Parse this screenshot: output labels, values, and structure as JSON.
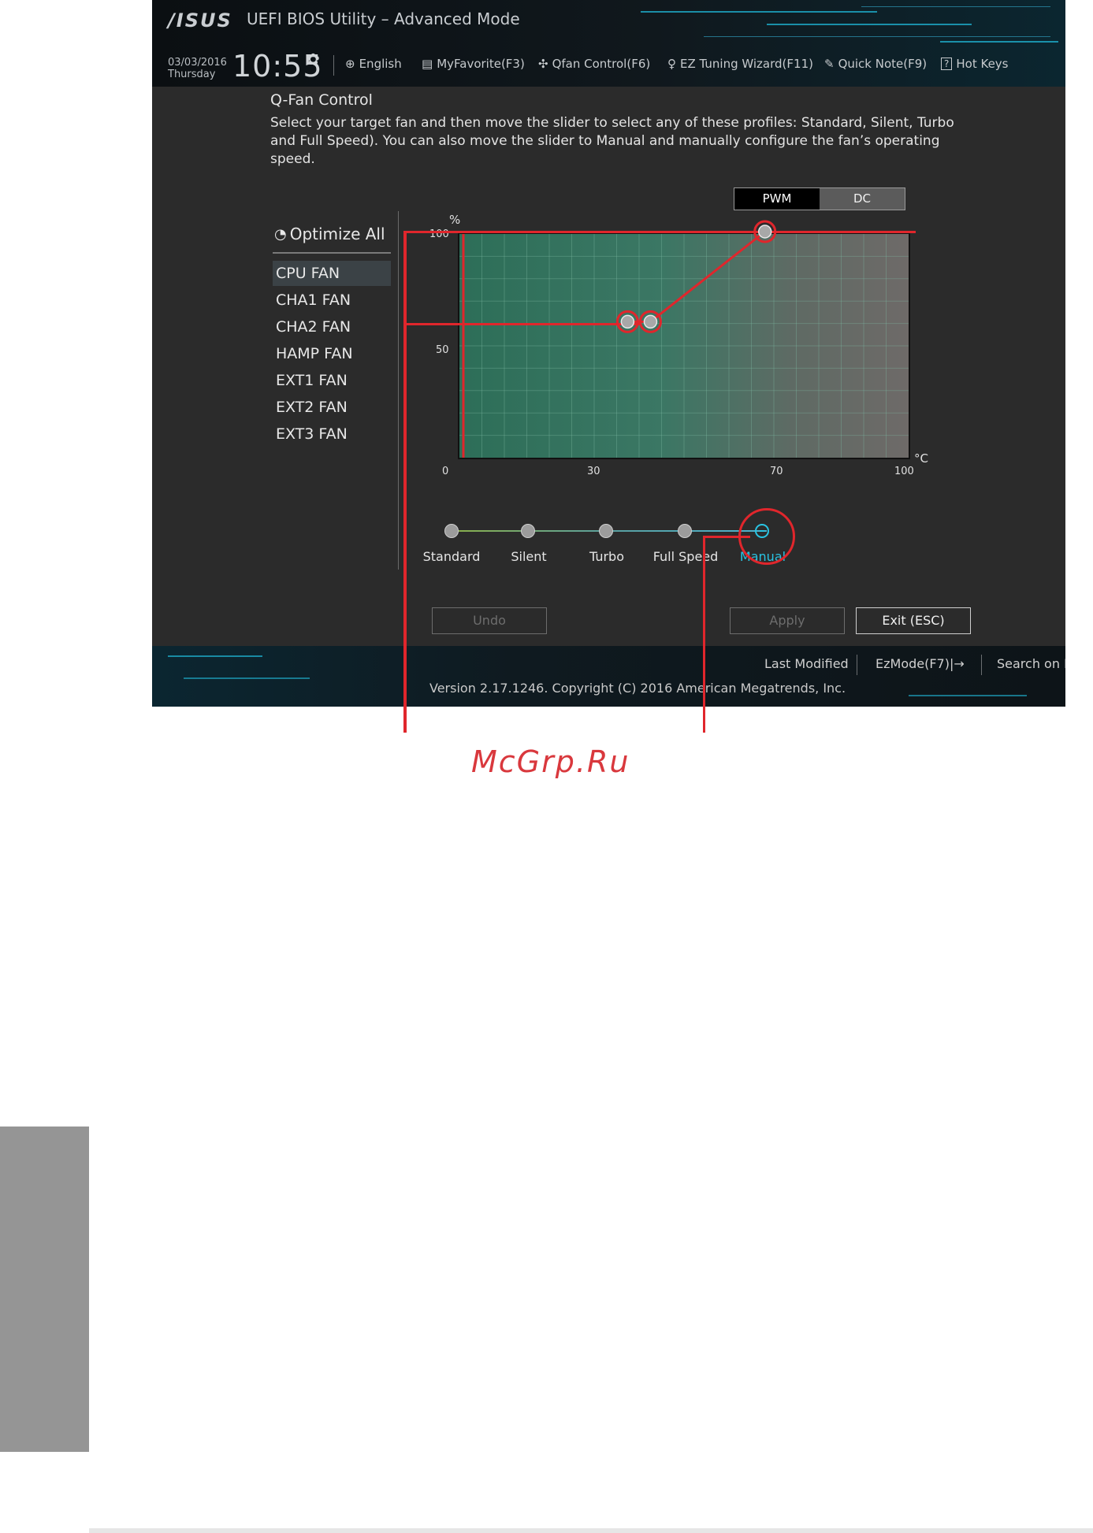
{
  "header": {
    "logo": "/ISUS",
    "title": "UEFI BIOS Utility – Advanced Mode",
    "date": "03/03/2016",
    "weekday": "Thursday",
    "time": "10:55",
    "menu": [
      {
        "icon": "globe-icon",
        "label": "English"
      },
      {
        "icon": "favorite-list-icon",
        "label": "MyFavorite(F3)"
      },
      {
        "icon": "fan-icon",
        "label": "Qfan Control(F6)"
      },
      {
        "icon": "lightbulb-icon",
        "label": "EZ Tuning Wizard(F11)"
      },
      {
        "icon": "note-icon",
        "label": "Quick Note(F9)"
      },
      {
        "icon": "hotkey-icon",
        "label": "Hot Keys"
      }
    ]
  },
  "qfan": {
    "title": "Q-Fan Control",
    "description": "Select your target fan and then move the slider to select any of these profiles: Standard, Silent, Turbo and Full Speed). You can also move the slider to Manual and manually configure the fan’s operating speed."
  },
  "sidebar": {
    "optimize_all": "Optimize All",
    "fans": [
      {
        "label": "CPU FAN",
        "selected": true
      },
      {
        "label": "CHA1 FAN",
        "selected": false
      },
      {
        "label": "CHA2 FAN",
        "selected": false
      },
      {
        "label": "HAMP FAN",
        "selected": false
      },
      {
        "label": "EXT1 FAN",
        "selected": false
      },
      {
        "label": "EXT2 FAN",
        "selected": false
      },
      {
        "label": "EXT3 FAN",
        "selected": false
      }
    ]
  },
  "graph": {
    "mode_pwm": "PWM",
    "mode_dc": "DC",
    "y_unit": "%",
    "x_unit": "°C",
    "y_ticks": [
      "100",
      "50"
    ],
    "x_ticks": [
      "0",
      "30",
      "70",
      "100"
    ],
    "points": [
      {
        "temp": 40,
        "speed": 60
      },
      {
        "temp": 45,
        "speed": 60
      },
      {
        "temp": 70,
        "speed": 100
      }
    ],
    "x_range": [
      0,
      100
    ],
    "y_range": [
      0,
      100
    ]
  },
  "profiles": {
    "items": [
      "Standard",
      "Silent",
      "Turbo",
      "Full Speed",
      "Manual"
    ],
    "selected": "Manual",
    "accent": "#29c4e3"
  },
  "buttons": {
    "undo": "Undo",
    "apply": "Apply",
    "exit": "Exit (ESC)"
  },
  "footer": {
    "last_modified": "Last Modified",
    "ezmode": "EzMode(F7)|→",
    "search": "Search on FAQ",
    "version": "Version 2.17.1246. Copyright (C) 2016 American Megatrends, Inc."
  },
  "watermark": "McGrp.Ru",
  "colors": {
    "annotation_red": "#e0262c",
    "watermark_red": "#d9383d"
  }
}
